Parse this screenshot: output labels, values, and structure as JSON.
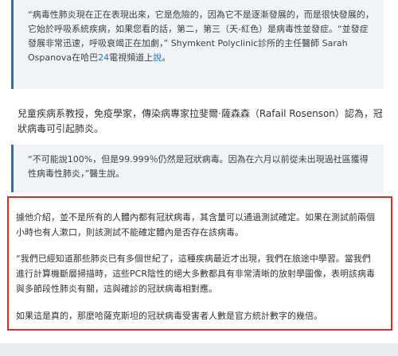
{
  "quote1": {
    "text_a": "“病毒性肺炎現在正在表現出來，它是危險的，因為它不是逐漸發展的，而是很快發展的，它始於呼吸系統疾病，如果您看的話，第二，第三（天-紅色）是病毒性並發症。“並發症發展非常迅速，呼吸衰竭正在加劇，” Shymkent Polyclinic診所的主任醫師 Sarah Ospanova在哈巴",
    "link_num": "24",
    "text_b": "電視頻道上",
    "link_say": "說",
    "text_c": "。"
  },
  "main_paragraph": "兒童疾病系教授，免疫學家，傳染病專家拉斐爾·薩森森（Rafail Rosenson）認為，冠狀病毒可引起肺炎。",
  "quote2": {
    "text": "“不可能說100%，但是99.999％仍然是冠狀病毒。因為在六月以前從未出現過社區獲得性病毒性肺炎，”醫生說。"
  },
  "boxed": {
    "p1": "據他介紹，並不是所有的人體內都有冠狀病毒，其含量可以通過測試確定。如果在測試前兩個小時也有人漱口，則該測試不能確定體內是否存在該病毒。",
    "p2": "“我們已經知道那些肺炎已有多個世紀了，這種疾病最近才出現，我們在旅途中學習。當我們進行計算機斷層掃描時，這些PCR陰性的絕大多數都具有非常清晰的放射學圖像，表明該病毒與多節段性肺炎有關，這與確診的冠狀病毒相對應。",
    "p3": "如果這是真的，那麼哈薩克斯坦的冠狀病毒受害者人數是官方統計數字的幾倍。"
  },
  "colors": {
    "accent_link": "#2474b5",
    "highlight_border": "#e02a2a",
    "quote_border": "#3a6e9c"
  }
}
